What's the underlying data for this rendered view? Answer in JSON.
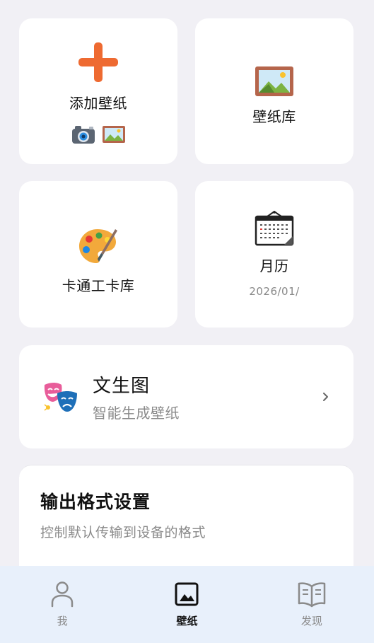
{
  "tiles": {
    "add_wallpaper": {
      "label": "添加壁纸",
      "icon": "plus-icon",
      "mini_icons": [
        "camera-icon",
        "framed-picture-icon"
      ]
    },
    "wallpaper_library": {
      "label": "壁纸库",
      "icon": "framed-picture-icon"
    },
    "cartoon_library": {
      "label": "卡通工卡库",
      "icon": "artist-palette-icon"
    },
    "calendar": {
      "label": "月历",
      "date": "2026/01/",
      "icon": "calendar-icon"
    }
  },
  "text_to_image": {
    "title": "文生图",
    "subtitle": "智能生成壁纸",
    "icon": "performing-arts-icon"
  },
  "output_format": {
    "title": "输出格式设置",
    "subtitle": "控制默认传输到设备的格式"
  },
  "bottom_nav": {
    "items": [
      {
        "label": "我",
        "icon": "person-icon",
        "active": false
      },
      {
        "label": "壁纸",
        "icon": "image-icon",
        "active": true
      },
      {
        "label": "发现",
        "icon": "book-icon",
        "active": false
      }
    ]
  },
  "colors": {
    "accent_plus": "#ee6a31",
    "nav_background": "#e8f0fb",
    "page_background": "#f1f0f5"
  }
}
